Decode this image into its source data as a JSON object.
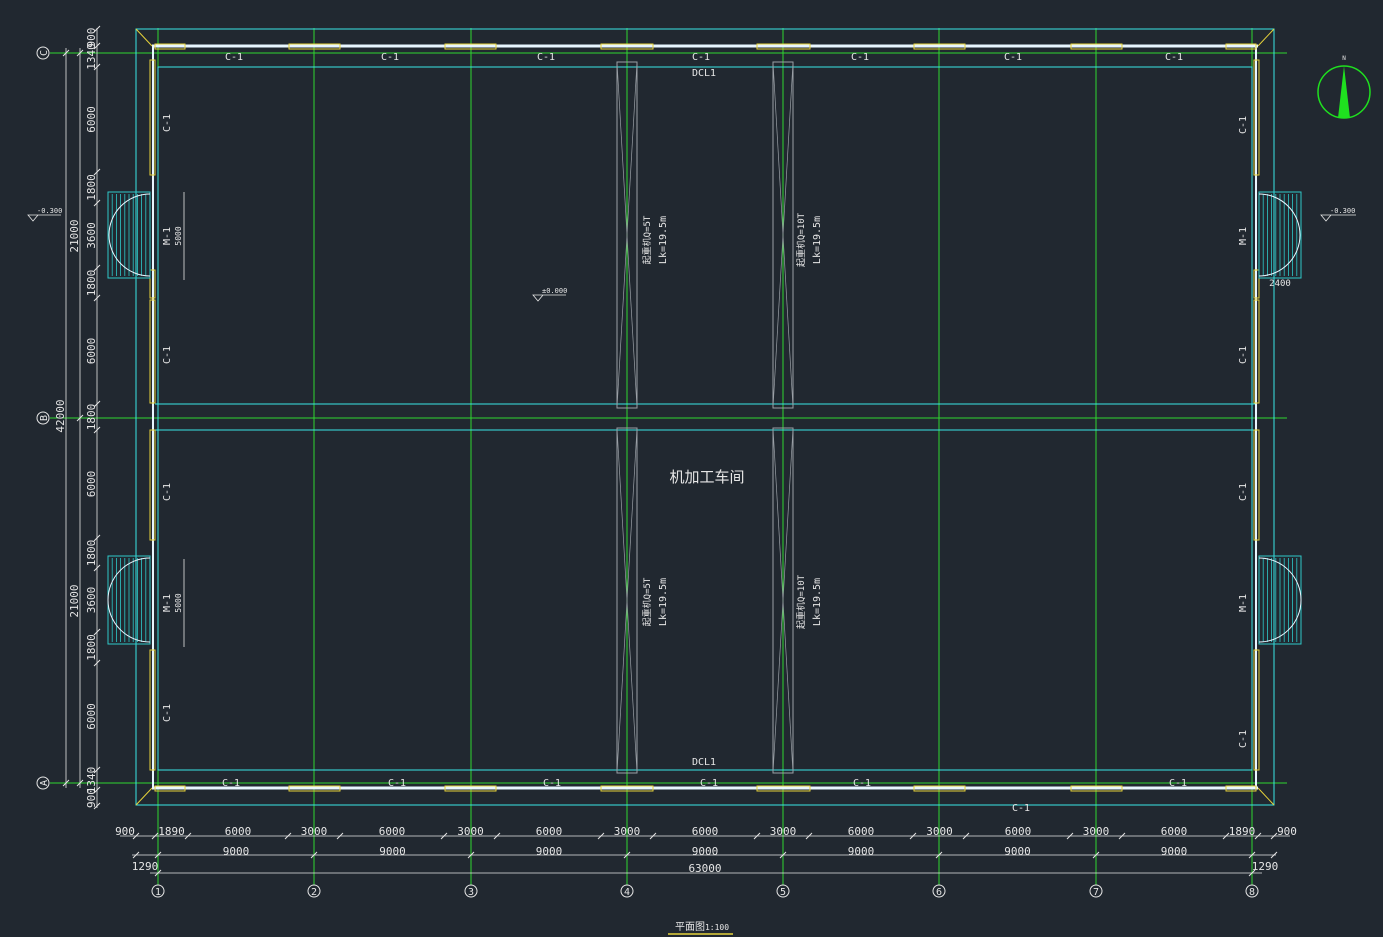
{
  "colors": {
    "background": "#212830",
    "grid_green": "#2fd62f",
    "wall_cyan": "#39e6e6",
    "wall_white": "#e8f6ff",
    "door_cyan": "#2ec9c9",
    "window_yellow": "#e6d23a",
    "text_white": "#e6e6e6",
    "crane_grey": "#9aa0a6",
    "compass_green": "#1fe01f"
  },
  "axis_labels_x": [
    "1",
    "2",
    "3",
    "4",
    "5",
    "6",
    "7",
    "8"
  ],
  "axis_labels_y_top": "C",
  "axis_labels_y_mid": "B",
  "axis_labels_y_bot": "A",
  "dims_bottom_row1": [
    "900",
    "1890",
    "6000",
    "3000",
    "6000",
    "3000",
    "6000",
    "3000",
    "6000",
    "3000",
    "6000",
    "3000",
    "6000",
    "3000",
    "6000",
    "1890",
    "900"
  ],
  "dims_bottom_row2": [
    "9000",
    "9000",
    "9000",
    "9000",
    "9000",
    "9000",
    "9000"
  ],
  "dims_bottom_row2_side": "1290",
  "dims_bottom_total": "63000",
  "dims_left_row1": [
    "900",
    "1340",
    "6000",
    "1800",
    "3600",
    "1800",
    "6000",
    "1800",
    "6000",
    "1800",
    "3600",
    "1800",
    "6000",
    "1340",
    "900"
  ],
  "dims_left_row2": [
    "21000",
    "21000"
  ],
  "dims_left_total": "42000",
  "door_width_dim": "5000",
  "porch_dim": "2400",
  "window_label": "C-1",
  "door_label": "M-1",
  "beam_label": "DCL1",
  "elevation_outdoor": "-0.300",
  "elevation_floor": "±0.000",
  "crane_5t_q": "起重机Q=5T",
  "crane_10t_q": "起重机Q=10T",
  "crane_span": "Lk=19.5m",
  "room_name": "机加工车间",
  "drawing_title": "平面图",
  "drawing_scale": "1:100",
  "north_label": "N"
}
